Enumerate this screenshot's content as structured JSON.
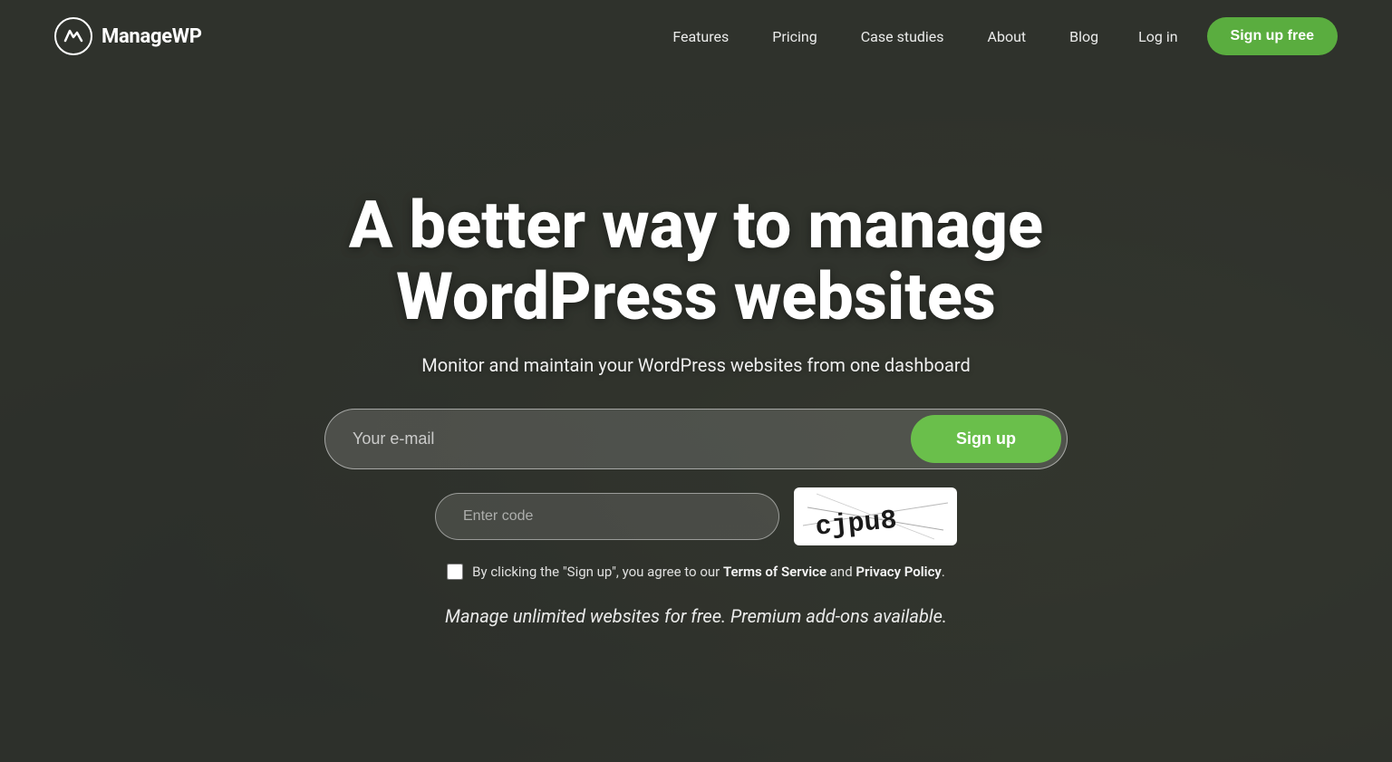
{
  "nav": {
    "logo_text": "ManageWP",
    "links": [
      {
        "id": "features",
        "label": "Features"
      },
      {
        "id": "pricing",
        "label": "Pricing"
      },
      {
        "id": "case-studies",
        "label": "Case studies"
      },
      {
        "id": "about",
        "label": "About"
      },
      {
        "id": "blog",
        "label": "Blog"
      }
    ],
    "login_label": "Log in",
    "signup_label": "Sign up free"
  },
  "hero": {
    "title": "A better way to manage WordPress websites",
    "subtitle": "Monitor and maintain your WordPress websites from one dashboard"
  },
  "form": {
    "email_placeholder": "Your e-mail",
    "signup_btn": "Sign up",
    "captcha_placeholder": "Enter code",
    "captcha_code": "cjpu8",
    "terms_text_before": "By clicking the \"Sign up\", you agree to our ",
    "terms_of_service": "Terms of Service",
    "terms_and": " and ",
    "privacy_policy": "Privacy Policy",
    "terms_text_after": "."
  },
  "tagline": "Manage unlimited websites for free. Premium add-ons available.",
  "colors": {
    "green": "#6abf4b",
    "green_dark": "#5aad3f"
  }
}
